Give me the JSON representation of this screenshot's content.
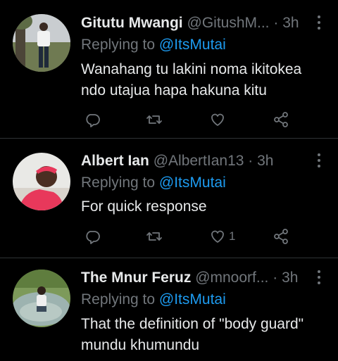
{
  "tweets": [
    {
      "name": "Gitutu Mwangi",
      "handle": "@GitushM...",
      "dot": "·",
      "time": "3h",
      "replying_prefix": "Replying to ",
      "replying_to": "@ItsMutai",
      "text_lines": [
        "Wanahang tu lakini noma ikitokea",
        "ndo utajua hapa hakuna kitu"
      ],
      "like_count": ""
    },
    {
      "name": "Albert Ian",
      "handle": "@AlbertIan13",
      "dot": "·",
      "time": "3h",
      "replying_prefix": "Replying to ",
      "replying_to": "@ItsMutai",
      "text_lines": [
        "For quick response"
      ],
      "like_count": "1"
    },
    {
      "name": "The Mnur Feruz",
      "handle": "@mnoorf...",
      "dot": "·",
      "time": "3h",
      "replying_prefix": "Replying to ",
      "replying_to": "@ItsMutai",
      "text_lines": [
        "That the definition of \"body guard\"",
        "mundu khumundu"
      ],
      "like_count": ""
    }
  ],
  "colors": {
    "background": "#000000",
    "text": "#e7e9ea",
    "muted": "#71767b",
    "accent": "#1d9bf0",
    "divider": "#2f3336"
  },
  "icons": [
    "reply-icon",
    "retweet-icon",
    "like-icon",
    "share-icon",
    "more-icon"
  ]
}
